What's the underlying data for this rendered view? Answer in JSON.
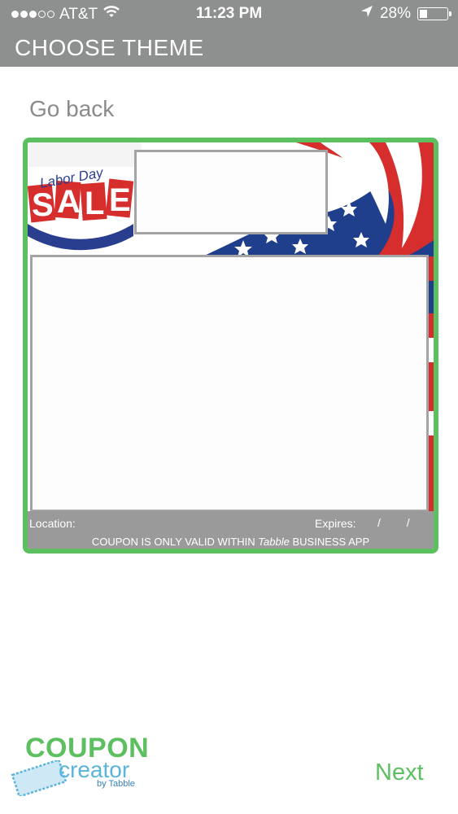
{
  "status_bar": {
    "carrier": "AT&T",
    "time": "11:23 PM",
    "battery": "28%",
    "battery_level": 0.28,
    "signal_bars": 3,
    "icons": [
      "signal-dots-icon",
      "wifi-icon",
      "location-arrow-icon",
      "battery-icon"
    ]
  },
  "header": {
    "title": "CHOOSE THEME"
  },
  "nav": {
    "go_back": "Go back",
    "next": "Next"
  },
  "coupon": {
    "banner_line1": "Labor Day",
    "banner_line2": "SALE",
    "location_label": "Location:",
    "expires_label": "Expires:",
    "expires_value": "/ /",
    "disclaimer_prefix": "COUPON IS ONLY VALID WITHIN",
    "disclaimer_brand": "Tabble",
    "disclaimer_suffix": "BUSINESS APP",
    "frame_color": "#5cbf60"
  },
  "logo": {
    "word": "COUPON",
    "sub": "creator",
    "by": "by Tabble"
  },
  "colors": {
    "accent": "#5cbf60",
    "bar": "#8e8f8f",
    "muted_text": "#8b8b8b"
  }
}
